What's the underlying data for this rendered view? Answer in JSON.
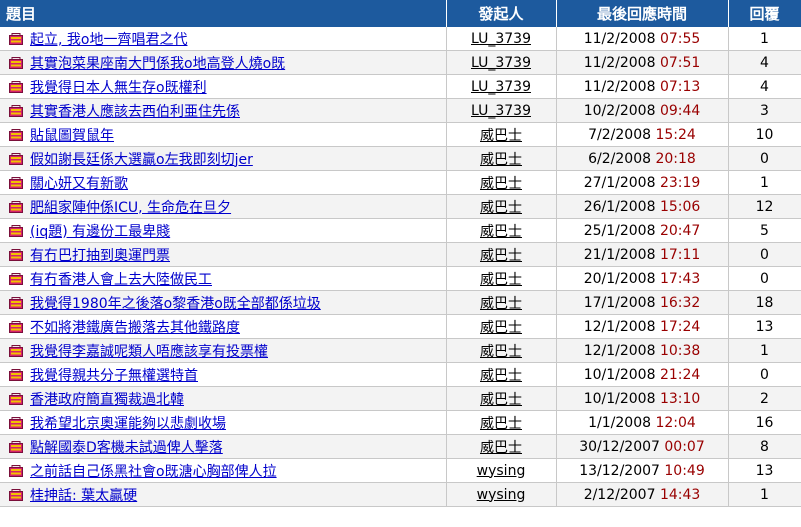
{
  "header": {
    "title": "題目",
    "author": "發起人",
    "last_reply": "最後回應時間",
    "replies": "回覆"
  },
  "colors": {
    "header_bg": "#1d5a9e",
    "link": "#0000cc",
    "time": "#990000",
    "icon_primary": "#d6226d",
    "icon_secondary": "#f2c200"
  },
  "icon_name": "folder-topic-icon",
  "rows": [
    {
      "title": "起立, 我o地一齊唱君之代",
      "author": "LU_3739",
      "date": "11/2/2008",
      "time": "07:55",
      "replies": "1"
    },
    {
      "title": "其實泡菜果座南大門係我o地高登人燒o既",
      "author": "LU_3739",
      "date": "11/2/2008",
      "time": "07:51",
      "replies": "4"
    },
    {
      "title": "我覺得日本人無生存o既權利",
      "author": "LU_3739",
      "date": "11/2/2008",
      "time": "07:13",
      "replies": "4"
    },
    {
      "title": "其實香港人應該去西伯利亜住先係",
      "author": "LU_3739",
      "date": "10/2/2008",
      "time": "09:44",
      "replies": "3"
    },
    {
      "title": "貼鼠圖賀鼠年",
      "author": "威巴士",
      "date": "7/2/2008",
      "time": "15:24",
      "replies": "10"
    },
    {
      "title": "假如謝長廷係大選贏o左我即刻切jer",
      "author": "威巴士",
      "date": "6/2/2008",
      "time": "20:18",
      "replies": "0"
    },
    {
      "title": "關心妍又有新歌",
      "author": "威巴士",
      "date": "27/1/2008",
      "time": "23:19",
      "replies": "1"
    },
    {
      "title": "肥組家陣仲係ICU, 生命危在旦夕",
      "author": "威巴士",
      "date": "26/1/2008",
      "time": "15:06",
      "replies": "12"
    },
    {
      "title": "(iq題) 有邊份工最卑賤",
      "author": "威巴士",
      "date": "25/1/2008",
      "time": "20:47",
      "replies": "5"
    },
    {
      "title": "有冇巴打抽到奧運門票",
      "author": "威巴士",
      "date": "21/1/2008",
      "time": "17:11",
      "replies": "0"
    },
    {
      "title": "有冇香港人會上去大陸做民工",
      "author": "威巴士",
      "date": "20/1/2008",
      "time": "17:43",
      "replies": "0"
    },
    {
      "title": "我覺得1980年之後落o黎香港o既全部都係垃圾",
      "author": "威巴士",
      "date": "17/1/2008",
      "time": "16:32",
      "replies": "18"
    },
    {
      "title": "不如將港鐵廣告搬落去其他鐵路度",
      "author": "威巴士",
      "date": "12/1/2008",
      "time": "17:24",
      "replies": "13"
    },
    {
      "title": "我覺得李嘉誠呢類人唔應該享有投票權",
      "author": "威巴士",
      "date": "12/1/2008",
      "time": "10:38",
      "replies": "1"
    },
    {
      "title": "我覺得親共分子無權選特首",
      "author": "威巴士",
      "date": "10/1/2008",
      "time": "21:24",
      "replies": "0"
    },
    {
      "title": "香港政府簡直獨裁過北韓",
      "author": "威巴士",
      "date": "10/1/2008",
      "time": "13:10",
      "replies": "2"
    },
    {
      "title": "我希望北京奧運能夠以悲劇收場",
      "author": "威巴士",
      "date": "1/1/2008",
      "time": "12:04",
      "replies": "16"
    },
    {
      "title": "點解國泰D客機未試過俾人擊落",
      "author": "威巴士",
      "date": "30/12/2007",
      "time": "00:07",
      "replies": "8"
    },
    {
      "title": "之前話自己係黑社會o既溏心胸部俾人拉",
      "author": "wysing",
      "date": "13/12/2007",
      "time": "10:49",
      "replies": "13"
    },
    {
      "title": "桂抻話: 葉太贏硬",
      "author": "wysing",
      "date": "2/12/2007",
      "time": "14:43",
      "replies": "1"
    }
  ]
}
